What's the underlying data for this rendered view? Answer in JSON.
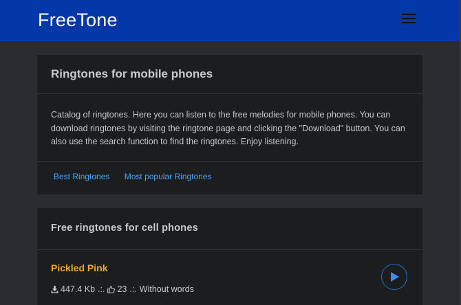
{
  "nav": {
    "brand": "FreeTone",
    "menu_icon": "hamburger-menu-icon"
  },
  "intro": {
    "title": "Ringtones for mobile phones",
    "description": "Catalog of ringtones. Here you can listen to the free melodies for mobile phones. You can download ringtones by visiting the ringtone page and clicking the \"Download\" button. You can also use the search function to find the ringtones. Enjoy listening.",
    "links": [
      {
        "label": "Best Ringtones"
      },
      {
        "label": "Most popular Ringtones"
      }
    ]
  },
  "list": {
    "title": "Free ringtones for cell phones",
    "items": [
      {
        "title": "Pickled Pink",
        "size": "447.4 Kb",
        "separator": ".:.",
        "likes": "23",
        "category": "Without words",
        "download_icon": "download-icon",
        "like_icon": "thumbs-up-icon",
        "play_icon": "play-icon"
      }
    ]
  },
  "colors": {
    "navbar": "#0437a8",
    "background": "#2b2c2f",
    "card": "#1c1d1f",
    "link": "#4aa3ff",
    "song_title": "#f5a623",
    "play_accent": "#1e6fcf"
  }
}
